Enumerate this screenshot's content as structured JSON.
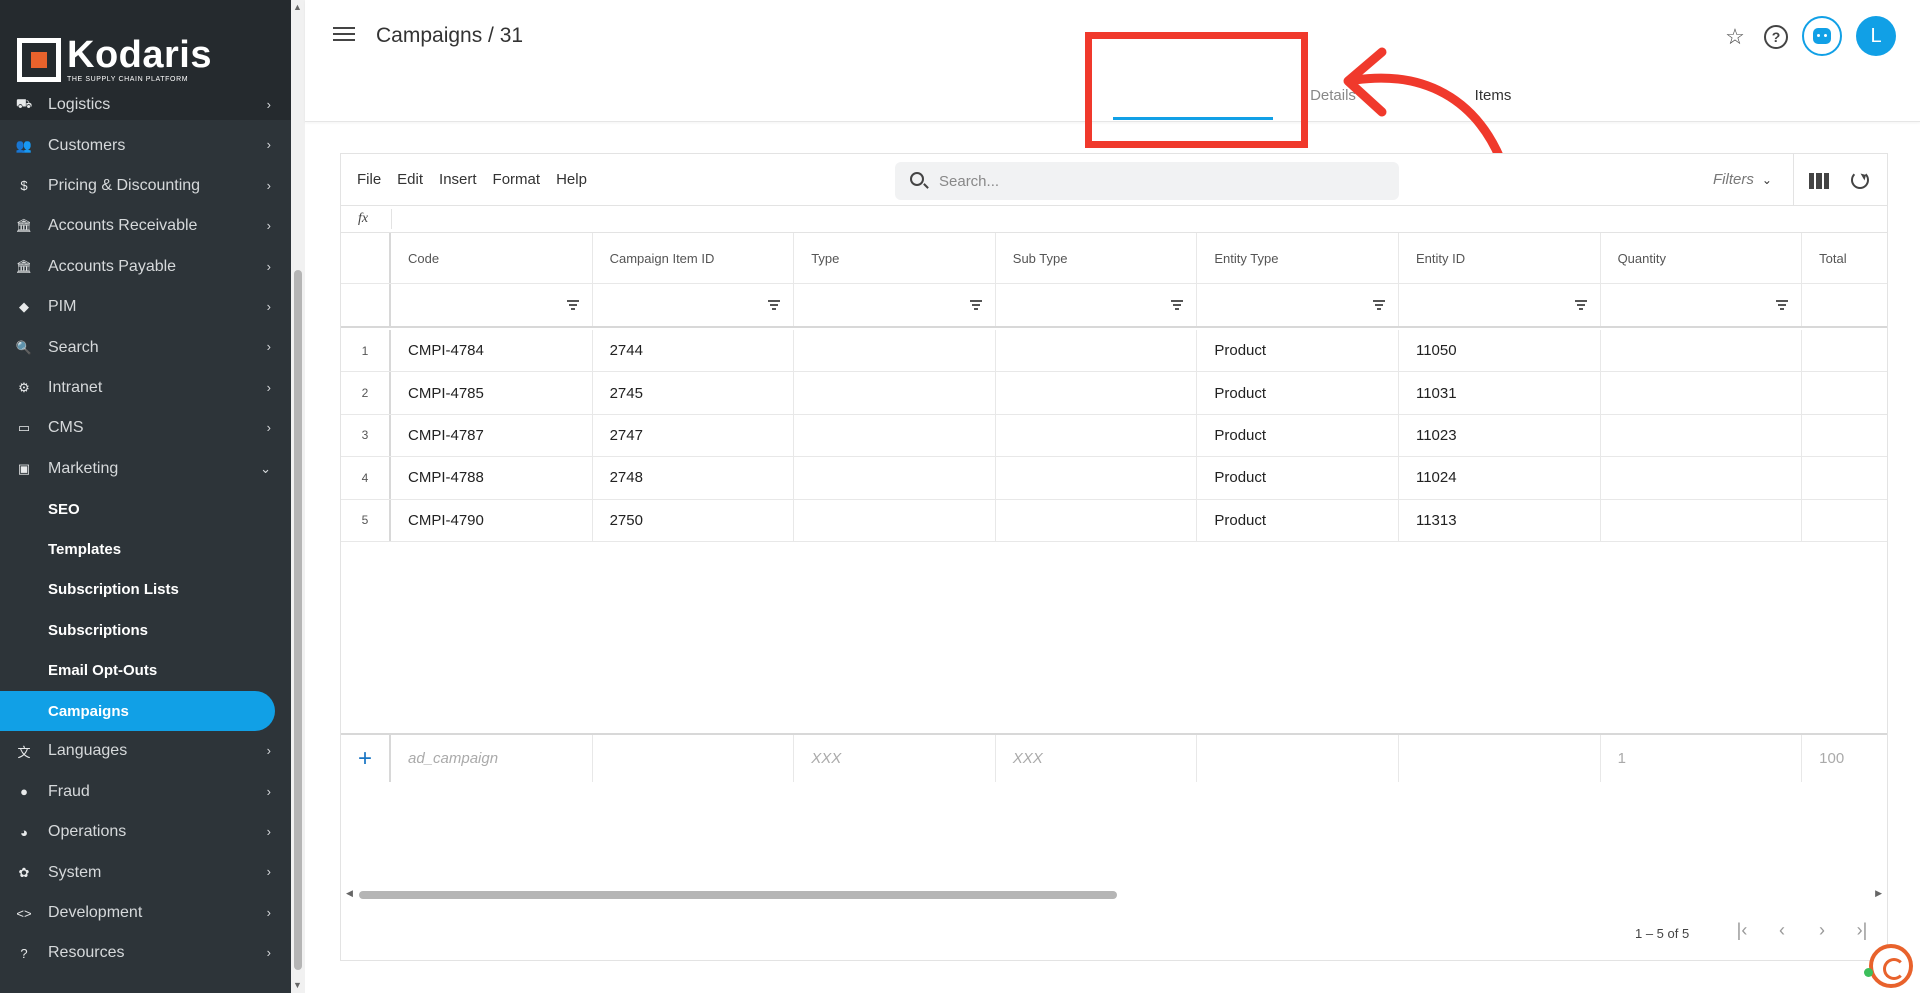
{
  "brand": {
    "name": "Kodaris",
    "tagline": "THE SUPPLY CHAIN PLATFORM",
    "accent": "#11a0e6",
    "logo_color": "#e8622c"
  },
  "sidebar": {
    "items": [
      {
        "label": "Logistics",
        "icon": "truck-icon",
        "glyph": "⛟"
      },
      {
        "label": "Customers",
        "icon": "people-icon",
        "glyph": "👥"
      },
      {
        "label": "Pricing & Discounting",
        "icon": "dollar-icon",
        "glyph": "$"
      },
      {
        "label": "Accounts Receivable",
        "icon": "bank-icon",
        "glyph": "🏛"
      },
      {
        "label": "Accounts Payable",
        "icon": "bank-icon",
        "glyph": "🏛"
      },
      {
        "label": "PIM",
        "icon": "tag-icon",
        "glyph": "◆"
      },
      {
        "label": "Search",
        "icon": "search-icon",
        "glyph": "🔍"
      },
      {
        "label": "Intranet",
        "icon": "network-icon",
        "glyph": "⚙"
      },
      {
        "label": "CMS",
        "icon": "card-icon",
        "glyph": "▭"
      },
      {
        "label": "Marketing",
        "icon": "megaphone-icon",
        "glyph": "▣"
      }
    ],
    "marketing_sub": [
      "SEO",
      "Templates",
      "Subscription Lists",
      "Subscriptions",
      "Email Opt-Outs",
      "Campaigns"
    ],
    "items_after": [
      {
        "label": "Languages",
        "icon": "translate-icon",
        "glyph": "文"
      },
      {
        "label": "Fraud",
        "icon": "alert-icon",
        "glyph": "●"
      },
      {
        "label": "Operations",
        "icon": "palette-icon",
        "glyph": "◕"
      },
      {
        "label": "System",
        "icon": "gear-icon",
        "glyph": "✿"
      },
      {
        "label": "Development",
        "icon": "code-icon",
        "glyph": "<>"
      },
      {
        "label": "Resources",
        "icon": "help-icon",
        "glyph": "?"
      }
    ]
  },
  "header": {
    "title": "Campaigns / 31",
    "tabs": [
      "Details",
      "Items"
    ],
    "active_tab": "Items",
    "avatar_initial": "L"
  },
  "toolbar": {
    "menu": [
      "File",
      "Edit",
      "Insert",
      "Format",
      "Help"
    ],
    "search_placeholder": "Search...",
    "filters_label": "Filters"
  },
  "formula_bar": {
    "label": "fx"
  },
  "table": {
    "columns": [
      "Code",
      "Campaign Item ID",
      "Type",
      "Sub Type",
      "Entity Type",
      "Entity ID",
      "Quantity",
      "Total"
    ],
    "rows": [
      {
        "n": "1",
        "cells": [
          "CMPI-4784",
          "2744",
          "",
          "",
          "Product",
          "11050",
          "",
          ""
        ]
      },
      {
        "n": "2",
        "cells": [
          "CMPI-4785",
          "2745",
          "",
          "",
          "Product",
          "11031",
          "",
          ""
        ]
      },
      {
        "n": "3",
        "cells": [
          "CMPI-4787",
          "2747",
          "",
          "",
          "Product",
          "11023",
          "",
          ""
        ]
      },
      {
        "n": "4",
        "cells": [
          "CMPI-4788",
          "2748",
          "",
          "",
          "Product",
          "11024",
          "",
          ""
        ]
      },
      {
        "n": "5",
        "cells": [
          "CMPI-4790",
          "2750",
          "",
          "",
          "Product",
          "11313",
          "",
          ""
        ]
      }
    ],
    "add_row": [
      "ad_campaign",
      "",
      "XXX",
      "XXX",
      "",
      "",
      "1",
      "100"
    ]
  },
  "pager": {
    "info": "1 – 5 of 5"
  }
}
